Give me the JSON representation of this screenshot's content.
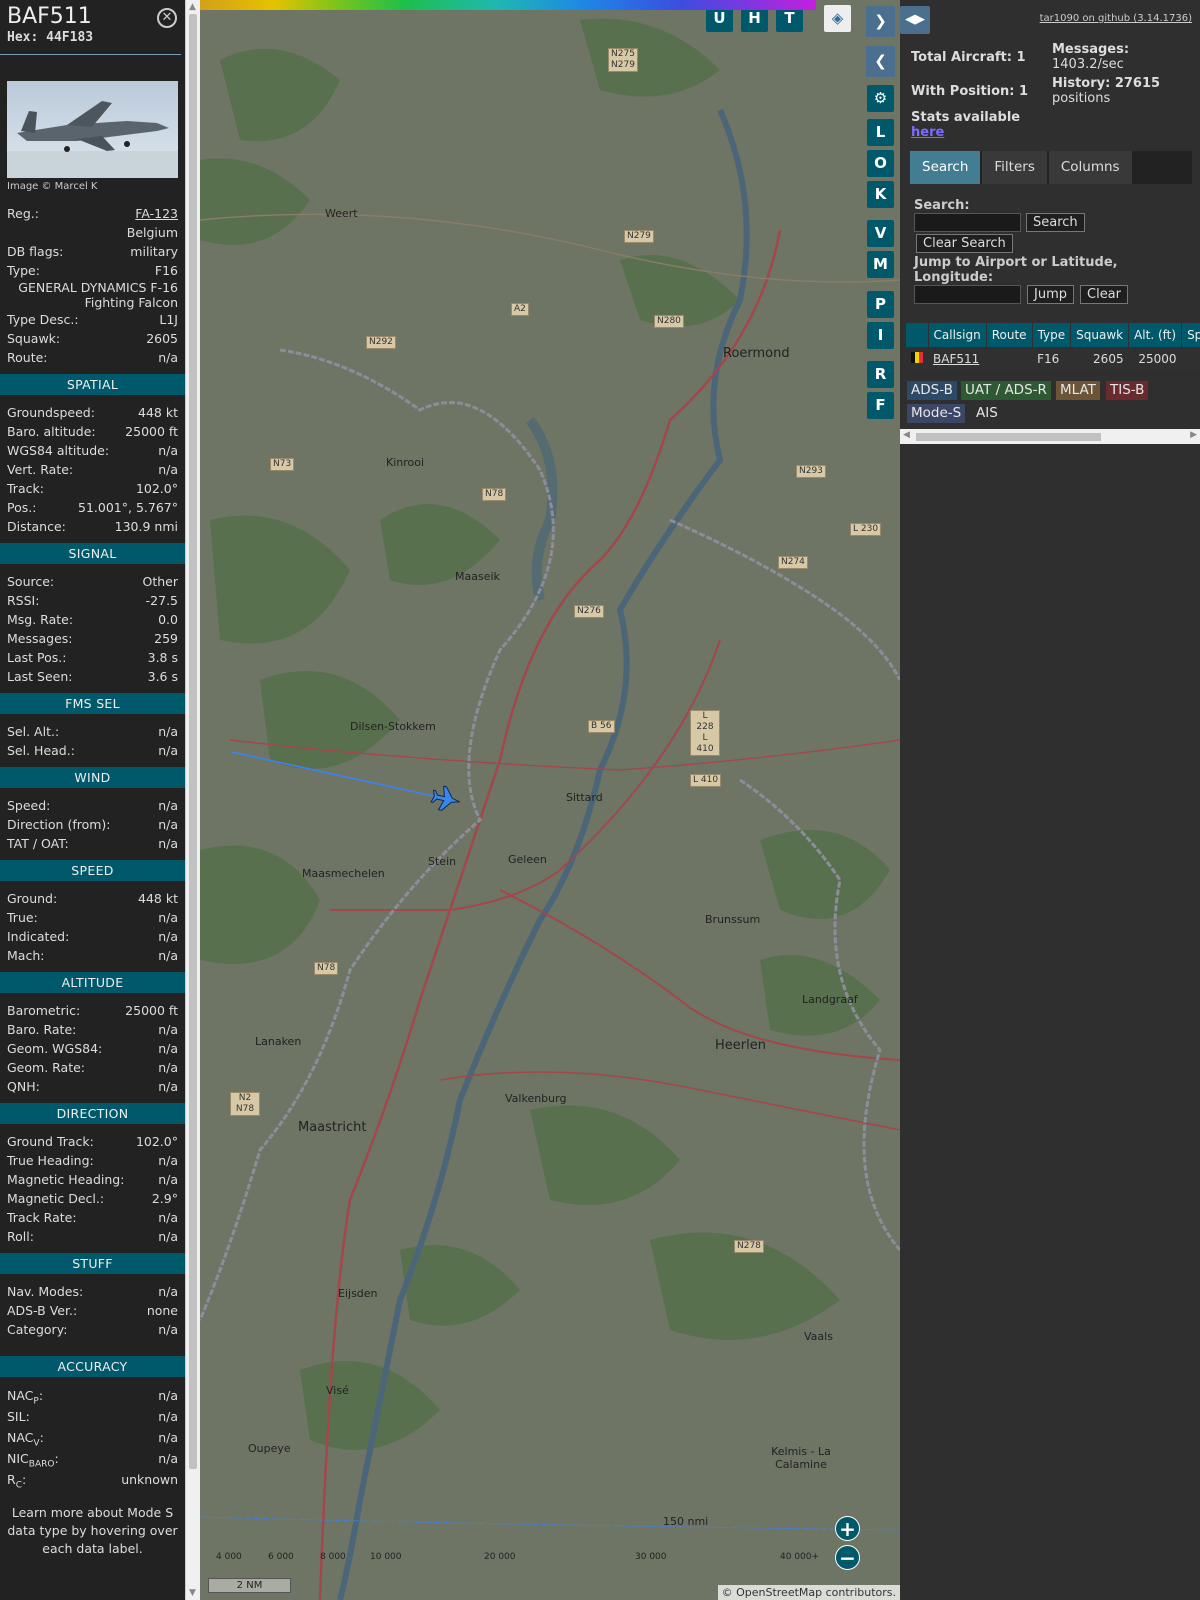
{
  "info": {
    "callsign": "BAF511",
    "hex": "Hex: 44F183",
    "photo_credit": "Image © Marcel K",
    "basic": [
      {
        "k": "Reg.:",
        "v": "FA-123",
        "link": true
      },
      {
        "k": "",
        "v": "Belgium"
      },
      {
        "k": "DB flags:",
        "v": "military"
      },
      {
        "k": "Type:",
        "v": "F16"
      }
    ],
    "type_full": "GENERAL DYNAMICS F-16 Fighting Falcon",
    "basic2": [
      {
        "k": "Type Desc.:",
        "v": "L1J"
      },
      {
        "k": "Squawk:",
        "v": "2605"
      },
      {
        "k": "Route:",
        "v": "n/a"
      }
    ],
    "sections": [
      {
        "title": "SPATIAL",
        "rows": [
          {
            "k": "Groundspeed:",
            "v": "448 kt"
          },
          {
            "k": "Baro. altitude:",
            "v": "25000 ft"
          },
          {
            "k": "WGS84 altitude:",
            "v": "n/a"
          },
          {
            "k": "Vert. Rate:",
            "v": "n/a"
          },
          {
            "k": "Track:",
            "v": "102.0°"
          },
          {
            "k": "Pos.:",
            "v": "51.001°, 5.767°"
          },
          {
            "k": "Distance:",
            "v": "130.9 nmi"
          }
        ]
      },
      {
        "title": "SIGNAL",
        "rows": [
          {
            "k": "Source:",
            "v": "Other"
          },
          {
            "k": "RSSI:",
            "v": "-27.5"
          },
          {
            "k": "Msg. Rate:",
            "v": "0.0"
          },
          {
            "k": "Messages:",
            "v": "259"
          },
          {
            "k": "Last Pos.:",
            "v": "3.8 s"
          },
          {
            "k": "Last Seen:",
            "v": "3.6 s"
          }
        ]
      },
      {
        "title": "FMS SEL",
        "rows": [
          {
            "k": "Sel. Alt.:",
            "v": "n/a"
          },
          {
            "k": "Sel. Head.:",
            "v": "n/a"
          }
        ]
      },
      {
        "title": "WIND",
        "rows": [
          {
            "k": "Speed:",
            "v": "n/a"
          },
          {
            "k": "Direction (from):",
            "v": "n/a"
          },
          {
            "k": "TAT / OAT:",
            "v": "n/a"
          }
        ]
      },
      {
        "title": "SPEED",
        "rows": [
          {
            "k": "Ground:",
            "v": "448 kt"
          },
          {
            "k": "True:",
            "v": "n/a"
          },
          {
            "k": "Indicated:",
            "v": "n/a"
          },
          {
            "k": "Mach:",
            "v": "n/a"
          }
        ]
      },
      {
        "title": "ALTITUDE",
        "rows": [
          {
            "k": "Barometric:",
            "v": "25000 ft"
          },
          {
            "k": "Baro. Rate:",
            "v": "n/a"
          },
          {
            "k": "Geom. WGS84:",
            "v": "n/a"
          },
          {
            "k": "Geom. Rate:",
            "v": "n/a"
          },
          {
            "k": "QNH:",
            "v": "n/a"
          }
        ]
      },
      {
        "title": "DIRECTION",
        "rows": [
          {
            "k": "Ground Track:",
            "v": "102.0°"
          },
          {
            "k": "True Heading:",
            "v": "n/a"
          },
          {
            "k": "Magnetic Heading:",
            "v": "n/a"
          },
          {
            "k": "Magnetic Decl.:",
            "v": "2.9°"
          },
          {
            "k": "Track Rate:",
            "v": "n/a"
          },
          {
            "k": "Roll:",
            "v": "n/a"
          }
        ]
      },
      {
        "title": "STUFF",
        "rows": [
          {
            "k": "Nav. Modes:",
            "v": "n/a"
          },
          {
            "k": "ADS-B Ver.:",
            "v": "none"
          },
          {
            "k": "Category:",
            "v": "n/a"
          }
        ]
      }
    ],
    "accuracy_title": "ACCURACY",
    "accuracy": [
      {
        "k": "NAC",
        "sub": "P",
        "v": "n/a"
      },
      {
        "k": "SIL:",
        "sub": "",
        "v": "n/a"
      },
      {
        "k": "NAC",
        "sub": "V",
        "v": "n/a"
      },
      {
        "k": "NIC",
        "sub": "BARO",
        "v": "n/a"
      },
      {
        "k": "R",
        "sub": "C",
        "v": "unknown"
      }
    ],
    "footer": "Learn more about Mode S data type by hovering over each data label."
  },
  "map": {
    "buttons_top": [
      "U",
      "H",
      "T"
    ],
    "buttons_side": [
      "L",
      "O",
      "K",
      "V",
      "M",
      "P",
      "I",
      "R",
      "F"
    ],
    "towns": [
      {
        "n": "Weert",
        "c": "t1"
      },
      {
        "n": "Roermond",
        "c": "t2"
      },
      {
        "n": "Kinrooi",
        "c": "t3"
      },
      {
        "n": "Maaseik",
        "c": "t4"
      },
      {
        "n": "Dilsen-Stokkem",
        "c": "t5"
      },
      {
        "n": "Sittard",
        "c": "t6"
      },
      {
        "n": "Maasmechelen",
        "c": "t7"
      },
      {
        "n": "Stein",
        "c": "t8"
      },
      {
        "n": "Geleen",
        "c": "t9"
      },
      {
        "n": "Brunssum",
        "c": "t10"
      },
      {
        "n": "Landgraaf",
        "c": "t11"
      },
      {
        "n": "Lanaken",
        "c": "t12"
      },
      {
        "n": "Heerlen",
        "c": "t13"
      },
      {
        "n": "Valkenburg",
        "c": "t14"
      },
      {
        "n": "Maastricht",
        "c": "t15"
      },
      {
        "n": "Eijsden",
        "c": "t16"
      },
      {
        "n": "Vaals",
        "c": "t17"
      },
      {
        "n": "Visé",
        "c": "t18"
      },
      {
        "n": "Oupeye",
        "c": "t19"
      },
      {
        "n": "Kelmis - La Calamine",
        "c": "t20"
      }
    ],
    "roads": [
      {
        "n": "N275 N279",
        "c": "r1"
      },
      {
        "n": "N292",
        "c": "r2"
      },
      {
        "n": "N279",
        "c": "r3"
      },
      {
        "n": "A2",
        "c": "r4"
      },
      {
        "n": "N280",
        "c": "r5"
      },
      {
        "n": "N73",
        "c": "r6"
      },
      {
        "n": "N78",
        "c": "r7"
      },
      {
        "n": "N293",
        "c": "r8"
      },
      {
        "n": "N274",
        "c": "r9"
      },
      {
        "n": "N276",
        "c": "r10"
      },
      {
        "n": "B 56",
        "c": "r11"
      },
      {
        "n": "L 228 L 410",
        "c": "r12"
      },
      {
        "n": "L 410",
        "c": "r13"
      },
      {
        "n": "N78",
        "c": "r14"
      },
      {
        "n": "N2 N78",
        "c": "r15"
      },
      {
        "n": "N278",
        "c": "r16"
      },
      {
        "n": "L 230",
        "c": "r17"
      }
    ],
    "colorbar_labels": [
      "4 000",
      "6 000",
      "8 000",
      "10 000",
      "20 000",
      "30 000",
      "40 000+"
    ],
    "scale_nm": "2 NM",
    "scale_top": "150 nmi",
    "zoom_in": "+",
    "zoom_out": "−",
    "attribution": "© OpenStreetMap contributors."
  },
  "side": {
    "github": "tar1090 on github (3.14.1736)",
    "total_aircraft": "Total Aircraft: 1",
    "with_position": "With Position: 1",
    "messages_label": "Messages:",
    "messages_value": "1403.2/sec",
    "history_label": "History: 27615",
    "history_value": "positions",
    "stats_text": "Stats available",
    "stats_link": "here",
    "tabs": [
      "Search",
      "Filters",
      "Columns"
    ],
    "search_label": "Search:",
    "search_button": "Search",
    "clear_search": "Clear Search",
    "jump_label": "Jump to Airport or Latitude, Longitude:",
    "jump_button": "Jump",
    "clear_button": "Clear",
    "table_headers": [
      "",
      "Callsign",
      "Route",
      "Type",
      "Squawk",
      "Alt. (ft)",
      "Spd."
    ],
    "table_row": [
      "",
      "BAF511",
      "",
      "F16",
      "2605",
      "25000",
      ""
    ],
    "sources": [
      {
        "n": "ADS-B",
        "bg": "#2c4a66",
        "fg": "#e6e6e6"
      },
      {
        "n": "UAT / ADS-R",
        "bg": "#2d5a33",
        "fg": "#e6e6e6"
      },
      {
        "n": "MLAT",
        "bg": "#6b5536",
        "fg": "#e6e6e6"
      },
      {
        "n": "TIS-B",
        "bg": "#6a2b2f",
        "fg": "#e6e6e6"
      },
      {
        "n": "Mode-S",
        "bg": "#3c4768",
        "fg": "#e6e6e6"
      },
      {
        "n": "AIS",
        "bg": "transparent",
        "fg": "#e6e6e6"
      }
    ]
  }
}
